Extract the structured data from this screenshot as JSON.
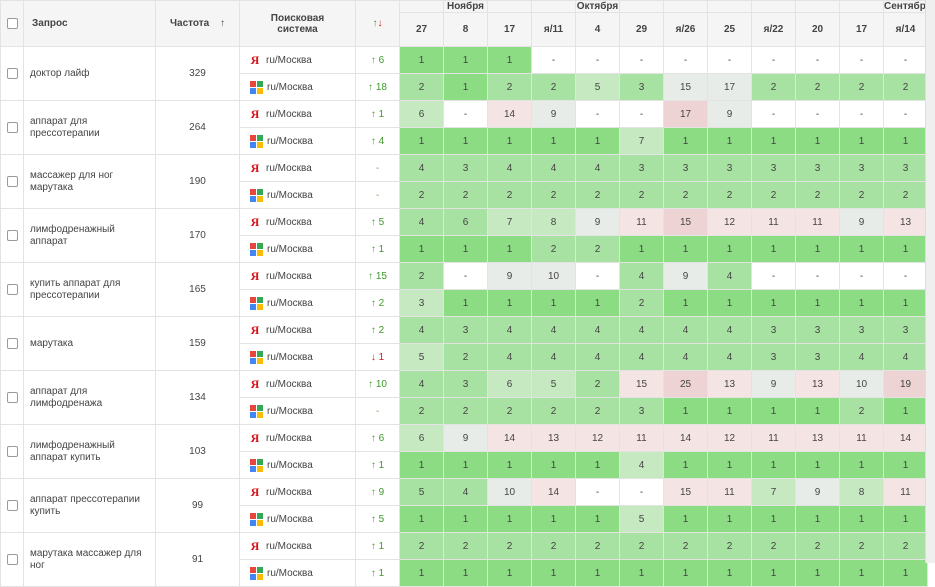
{
  "header": {
    "query_label": "Запрос",
    "freq_label": "Частота",
    "sort_arrow": "↑",
    "se_label_line1": "Поисковая",
    "se_label_line2": "система",
    "chg_up": "↑",
    "chg_down": "↓",
    "month_labels": [
      {
        "text": "Ноября",
        "col": 1
      },
      {
        "text": "Октября",
        "col": 4
      },
      {
        "text": "Сентября",
        "col": 11
      }
    ],
    "days": [
      {
        "label": "27",
        "weekend": false
      },
      {
        "label": "8",
        "weekend": false
      },
      {
        "label": "17",
        "weekend": false
      },
      {
        "label": "я/11",
        "weekend": true
      },
      {
        "label": "4",
        "weekend": false
      },
      {
        "label": "29",
        "weekend": false
      },
      {
        "label": "я/26",
        "weekend": true
      },
      {
        "label": "25",
        "weekend": false
      },
      {
        "label": "я/22",
        "weekend": true
      },
      {
        "label": "20",
        "weekend": false
      },
      {
        "label": "17",
        "weekend": false
      },
      {
        "label": "я/14",
        "weekend": true
      }
    ]
  },
  "colors": {
    "up": "#3d9a2b",
    "down": "#d8141d",
    "yandex_red": "#d8141d"
  },
  "icons": {
    "yandex": "yandex-logo-icon",
    "google": "google-logo-icon"
  },
  "rows": [
    {
      "query": "доктор лайф",
      "freq": "329",
      "yandex": {
        "region": "ru/Москва",
        "dir": "up",
        "chg": "6",
        "pos": [
          "1",
          "1",
          "1",
          "-",
          "-",
          "-",
          "-",
          "-",
          "-",
          "-",
          "-",
          "-"
        ],
        "lv": [
          1,
          1,
          1,
          0,
          0,
          0,
          0,
          0,
          0,
          0,
          0,
          0
        ]
      },
      "google": {
        "region": "ru/Москва",
        "dir": "up",
        "chg": "18",
        "pos": [
          "2",
          "1",
          "2",
          "2",
          "5",
          "3",
          "15",
          "17",
          "2",
          "2",
          "2",
          "2"
        ],
        "lv": [
          2,
          1,
          2,
          2,
          3,
          2,
          4,
          4,
          2,
          2,
          2,
          2
        ]
      }
    },
    {
      "query": "аппарат для прессотерапии",
      "freq": "264",
      "yandex": {
        "region": "ru/Москва",
        "dir": "up",
        "chg": "1",
        "pos": [
          "6",
          "-",
          "14",
          "9",
          "-",
          "-",
          "17",
          "9",
          "-",
          "-",
          "-",
          "-"
        ],
        "lv": [
          3,
          0,
          5,
          4,
          0,
          0,
          6,
          4,
          0,
          0,
          0,
          0
        ]
      },
      "google": {
        "region": "ru/Москва",
        "dir": "up",
        "chg": "4",
        "pos": [
          "1",
          "1",
          "1",
          "1",
          "1",
          "7",
          "1",
          "1",
          "1",
          "1",
          "1",
          "1"
        ],
        "lv": [
          1,
          1,
          1,
          1,
          1,
          3,
          1,
          1,
          1,
          1,
          1,
          1
        ]
      }
    },
    {
      "query": "массажер для ног марутака",
      "freq": "190",
      "yandex": {
        "region": "ru/Москва",
        "dir": "none",
        "chg": "-",
        "pos": [
          "4",
          "3",
          "4",
          "4",
          "4",
          "3",
          "3",
          "3",
          "3",
          "3",
          "3",
          "3"
        ],
        "lv": [
          2,
          2,
          2,
          2,
          2,
          2,
          2,
          2,
          2,
          2,
          2,
          2
        ]
      },
      "google": {
        "region": "ru/Москва",
        "dir": "none",
        "chg": "-",
        "pos": [
          "2",
          "2",
          "2",
          "2",
          "2",
          "2",
          "2",
          "2",
          "2",
          "2",
          "2",
          "2"
        ],
        "lv": [
          2,
          2,
          2,
          2,
          2,
          2,
          2,
          2,
          2,
          2,
          2,
          2
        ]
      }
    },
    {
      "query": "лимфодренажный аппарат",
      "freq": "170",
      "yandex": {
        "region": "ru/Москва",
        "dir": "up",
        "chg": "5",
        "pos": [
          "4",
          "6",
          "7",
          "8",
          "9",
          "11",
          "15",
          "12",
          "11",
          "11",
          "9",
          "13"
        ],
        "lv": [
          2,
          2,
          3,
          3,
          4,
          5,
          6,
          5,
          5,
          5,
          4,
          5
        ]
      },
      "google": {
        "region": "ru/Москва",
        "dir": "up",
        "chg": "1",
        "pos": [
          "1",
          "1",
          "1",
          "2",
          "2",
          "1",
          "1",
          "1",
          "1",
          "1",
          "1",
          "1"
        ],
        "lv": [
          1,
          1,
          1,
          2,
          2,
          1,
          1,
          1,
          1,
          1,
          1,
          1
        ]
      }
    },
    {
      "query": "купить аппарат для прессотерапии",
      "freq": "165",
      "yandex": {
        "region": "ru/Москва",
        "dir": "up",
        "chg": "15",
        "pos": [
          "2",
          "-",
          "9",
          "10",
          "-",
          "4",
          "9",
          "4",
          "-",
          "-",
          "-",
          "-"
        ],
        "lv": [
          2,
          0,
          4,
          4,
          0,
          2,
          4,
          2,
          0,
          0,
          0,
          0
        ]
      },
      "google": {
        "region": "ru/Москва",
        "dir": "up",
        "chg": "2",
        "pos": [
          "3",
          "1",
          "1",
          "1",
          "1",
          "2",
          "1",
          "1",
          "1",
          "1",
          "1",
          "1"
        ],
        "lv": [
          3,
          1,
          1,
          1,
          1,
          2,
          1,
          1,
          1,
          1,
          1,
          1
        ]
      }
    },
    {
      "query": "марутака",
      "freq": "159",
      "yandex": {
        "region": "ru/Москва",
        "dir": "up",
        "chg": "2",
        "pos": [
          "4",
          "3",
          "4",
          "4",
          "4",
          "4",
          "4",
          "4",
          "3",
          "3",
          "3",
          "3"
        ],
        "lv": [
          2,
          2,
          2,
          2,
          2,
          2,
          2,
          2,
          2,
          2,
          2,
          2
        ]
      },
      "google": {
        "region": "ru/Москва",
        "dir": "down",
        "chg": "1",
        "pos": [
          "5",
          "2",
          "4",
          "4",
          "4",
          "4",
          "4",
          "4",
          "3",
          "3",
          "4",
          "4"
        ],
        "lv": [
          3,
          2,
          2,
          2,
          2,
          2,
          2,
          2,
          2,
          2,
          2,
          2
        ]
      }
    },
    {
      "query": "аппарат для лимфодренажа",
      "freq": "134",
      "yandex": {
        "region": "ru/Москва",
        "dir": "up",
        "chg": "10",
        "pos": [
          "4",
          "3",
          "6",
          "5",
          "2",
          "15",
          "25",
          "13",
          "9",
          "13",
          "10",
          "19"
        ],
        "lv": [
          2,
          2,
          3,
          3,
          2,
          5,
          6,
          5,
          4,
          5,
          4,
          6
        ]
      },
      "google": {
        "region": "ru/Москва",
        "dir": "none",
        "chg": "-",
        "pos": [
          "2",
          "2",
          "2",
          "2",
          "2",
          "3",
          "1",
          "1",
          "1",
          "1",
          "2",
          "1"
        ],
        "lv": [
          2,
          2,
          2,
          2,
          2,
          2,
          1,
          1,
          1,
          1,
          2,
          1
        ]
      }
    },
    {
      "query": "лимфодренажный аппарат купить",
      "freq": "103",
      "yandex": {
        "region": "ru/Москва",
        "dir": "up",
        "chg": "6",
        "pos": [
          "6",
          "9",
          "14",
          "13",
          "12",
          "11",
          "14",
          "12",
          "11",
          "13",
          "11",
          "14"
        ],
        "lv": [
          3,
          4,
          5,
          5,
          5,
          5,
          5,
          5,
          5,
          5,
          5,
          5
        ]
      },
      "google": {
        "region": "ru/Москва",
        "dir": "up",
        "chg": "1",
        "pos": [
          "1",
          "1",
          "1",
          "1",
          "1",
          "4",
          "1",
          "1",
          "1",
          "1",
          "1",
          "1"
        ],
        "lv": [
          1,
          1,
          1,
          1,
          1,
          3,
          1,
          1,
          1,
          1,
          1,
          1
        ]
      }
    },
    {
      "query": "аппарат прессотерапии купить",
      "freq": "99",
      "yandex": {
        "region": "ru/Москва",
        "dir": "up",
        "chg": "9",
        "pos": [
          "5",
          "4",
          "10",
          "14",
          "-",
          "-",
          "15",
          "11",
          "7",
          "9",
          "8",
          "11"
        ],
        "lv": [
          2,
          2,
          4,
          5,
          0,
          0,
          5,
          5,
          3,
          4,
          3,
          5
        ]
      },
      "google": {
        "region": "ru/Москва",
        "dir": "up",
        "chg": "5",
        "pos": [
          "1",
          "1",
          "1",
          "1",
          "1",
          "5",
          "1",
          "1",
          "1",
          "1",
          "1",
          "1"
        ],
        "lv": [
          1,
          1,
          1,
          1,
          1,
          3,
          1,
          1,
          1,
          1,
          1,
          1
        ]
      }
    },
    {
      "query": "марутака массажер для ног",
      "freq": "91",
      "yandex": {
        "region": "ru/Москва",
        "dir": "up",
        "chg": "1",
        "pos": [
          "2",
          "2",
          "2",
          "2",
          "2",
          "2",
          "2",
          "2",
          "2",
          "2",
          "2",
          "2"
        ],
        "lv": [
          2,
          2,
          2,
          2,
          2,
          2,
          2,
          2,
          2,
          2,
          2,
          2
        ]
      },
      "google": {
        "region": "ru/Москва",
        "dir": "up",
        "chg": "1",
        "pos": [
          "1",
          "1",
          "1",
          "1",
          "1",
          "1",
          "1",
          "1",
          "1",
          "1",
          "1",
          "1"
        ],
        "lv": [
          1,
          1,
          1,
          1,
          1,
          1,
          1,
          1,
          1,
          1,
          1,
          1
        ]
      }
    }
  ]
}
